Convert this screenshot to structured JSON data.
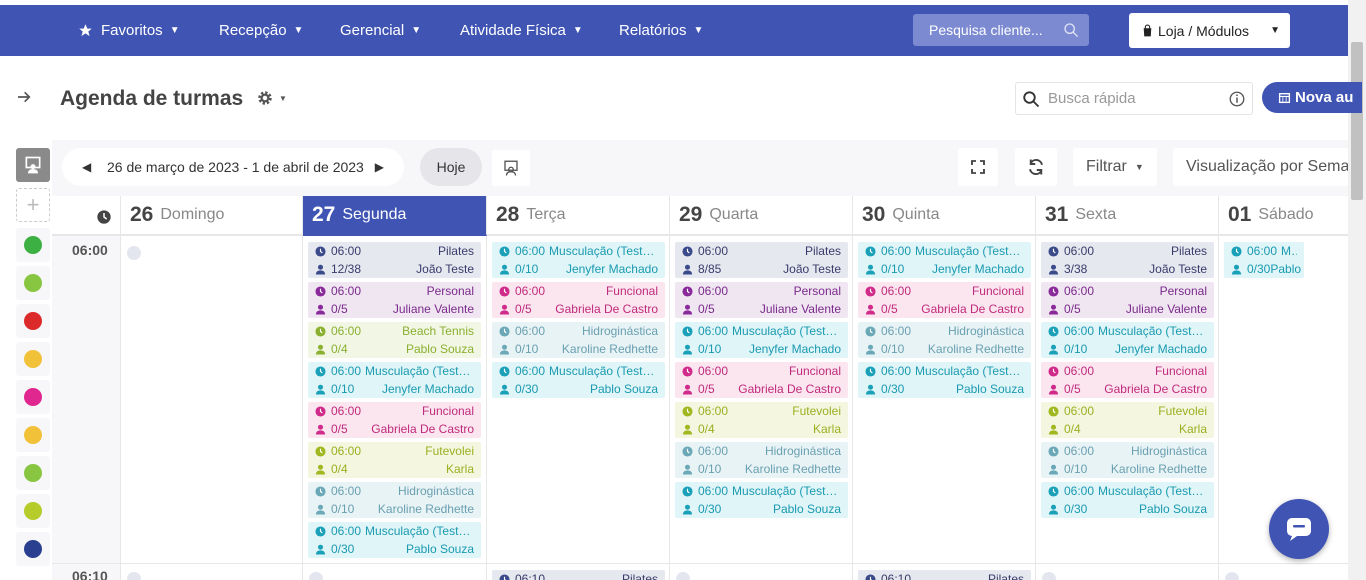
{
  "topnav": {
    "items": [
      {
        "label": "Favoritos"
      },
      {
        "label": "Recepção"
      },
      {
        "label": "Gerencial"
      },
      {
        "label": "Atividade Física"
      },
      {
        "label": "Relatórios"
      }
    ],
    "search_placeholder": "Pesquisa cliente...",
    "store_label": "Loja / Módulos"
  },
  "header": {
    "title": "Agenda de turmas",
    "quick_search_placeholder": "Busca rápida",
    "new_button": "Nova au"
  },
  "toolbar": {
    "date_range": "26 de março de 2023 - 1 de abril de 2023",
    "today": "Hoje",
    "filter": "Filtrar",
    "view": "Visualização por Seman"
  },
  "sidebar_colors": [
    "#3cb043",
    "#88c540",
    "#dc2a2a",
    "#f2c13a",
    "#e0278f",
    "#f2c13a",
    "#88c540",
    "#b5cc2a",
    "#2a3f8f"
  ],
  "days": [
    {
      "num": "26",
      "name": "Domingo",
      "active": false
    },
    {
      "num": "27",
      "name": "Segunda",
      "active": true
    },
    {
      "num": "28",
      "name": "Terça",
      "active": false
    },
    {
      "num": "29",
      "name": "Quarta",
      "active": false
    },
    {
      "num": "30",
      "name": "Quinta",
      "active": false
    },
    {
      "num": "31",
      "name": "Sexta",
      "active": false
    },
    {
      "num": "01",
      "name": "Sábado",
      "active": false
    }
  ],
  "slots": [
    "06:00",
    "06:10"
  ],
  "colors": {
    "Pilates": {
      "fg": "#3a3a6a",
      "bg": "#e6e8f0",
      "icon": "#3a4a8a"
    },
    "Personal": {
      "fg": "#7a2a8a",
      "bg": "#f0e6f2",
      "icon": "#8a2a9a"
    },
    "Beach Tennis": {
      "fg": "#8ab030",
      "bg": "#f2f6e4",
      "icon": "#8ab030"
    },
    "Musculacao": {
      "fg": "#1a9ab0",
      "bg": "#e0f5f8",
      "icon": "#1aa0b8"
    },
    "Funcional": {
      "fg": "#c02a7a",
      "bg": "#fbe6f0",
      "icon": "#d02a8a"
    },
    "Futevolei": {
      "fg": "#9ab020",
      "bg": "#f4f6e0",
      "icon": "#a0b820"
    },
    "Hidroginastica": {
      "fg": "#6aa0b0",
      "bg": "#e8f3f6",
      "icon": "#6aa8b8"
    }
  },
  "cards": {
    "d27": [
      {
        "time": "06:00",
        "title": "Pilates",
        "count": "12/38",
        "who": "João Teste",
        "style": "Pilates"
      },
      {
        "time": "06:00",
        "title": "Personal",
        "count": "0/5",
        "who": "Juliane Valente",
        "style": "Personal"
      },
      {
        "time": "06:00",
        "title": "Beach Tennis",
        "count": "0/4",
        "who": "Pablo Souza",
        "style": "Beach Tennis"
      },
      {
        "time": "06:00",
        "title": "Musculação (Teste ...",
        "count": "0/10",
        "who": "Jenyfer Machado",
        "style": "Musculacao"
      },
      {
        "time": "06:00",
        "title": "Funcional",
        "count": "0/5",
        "who": "Gabriela De Castro",
        "style": "Funcional"
      },
      {
        "time": "06:00",
        "title": "Futevolei",
        "count": "0/4",
        "who": "Karla",
        "style": "Futevolei"
      },
      {
        "time": "06:00",
        "title": "Hidroginástica",
        "count": "0/10",
        "who": "Karoline Redhette",
        "style": "Hidroginastica"
      },
      {
        "time": "06:00",
        "title": "Musculação (Teste ...",
        "count": "0/30",
        "who": "Pablo Souza",
        "style": "Musculacao"
      }
    ],
    "d28": [
      {
        "time": "06:00",
        "title": "Musculação (Teste ...",
        "count": "0/10",
        "who": "Jenyfer Machado",
        "style": "Musculacao"
      },
      {
        "time": "06:00",
        "title": "Funcional",
        "count": "0/5",
        "who": "Gabriela De Castro",
        "style": "Funcional"
      },
      {
        "time": "06:00",
        "title": "Hidroginástica",
        "count": "0/10",
        "who": "Karoline Redhette",
        "style": "Hidroginastica"
      },
      {
        "time": "06:00",
        "title": "Musculação (Teste ...",
        "count": "0/30",
        "who": "Pablo Souza",
        "style": "Musculacao"
      }
    ],
    "d29": [
      {
        "time": "06:00",
        "title": "Pilates",
        "count": "8/85",
        "who": "João Teste",
        "style": "Pilates"
      },
      {
        "time": "06:00",
        "title": "Personal",
        "count": "0/5",
        "who": "Juliane Valente",
        "style": "Personal"
      },
      {
        "time": "06:00",
        "title": "Musculação (Teste ...",
        "count": "0/10",
        "who": "Jenyfer Machado",
        "style": "Musculacao"
      },
      {
        "time": "06:00",
        "title": "Funcional",
        "count": "0/5",
        "who": "Gabriela De Castro",
        "style": "Funcional"
      },
      {
        "time": "06:00",
        "title": "Futevolei",
        "count": "0/4",
        "who": "Karla",
        "style": "Futevolei"
      },
      {
        "time": "06:00",
        "title": "Hidroginástica",
        "count": "0/10",
        "who": "Karoline Redhette",
        "style": "Hidroginastica"
      },
      {
        "time": "06:00",
        "title": "Musculação (Teste ...",
        "count": "0/30",
        "who": "Pablo Souza",
        "style": "Musculacao"
      }
    ],
    "d30": [
      {
        "time": "06:00",
        "title": "Musculação (Teste ...",
        "count": "0/10",
        "who": "Jenyfer Machado",
        "style": "Musculacao"
      },
      {
        "time": "06:00",
        "title": "Funcional",
        "count": "0/5",
        "who": "Gabriela De Castro",
        "style": "Funcional"
      },
      {
        "time": "06:00",
        "title": "Hidroginástica",
        "count": "0/10",
        "who": "Karoline Redhette",
        "style": "Hidroginastica"
      },
      {
        "time": "06:00",
        "title": "Musculação (Teste ...",
        "count": "0/30",
        "who": "Pablo Souza",
        "style": "Musculacao"
      }
    ],
    "d31": [
      {
        "time": "06:00",
        "title": "Pilates",
        "count": "3/38",
        "who": "João Teste",
        "style": "Pilates"
      },
      {
        "time": "06:00",
        "title": "Personal",
        "count": "0/5",
        "who": "Juliane Valente",
        "style": "Personal"
      },
      {
        "time": "06:00",
        "title": "Musculação (Teste ...",
        "count": "0/10",
        "who": "Jenyfer Machado",
        "style": "Musculacao"
      },
      {
        "time": "06:00",
        "title": "Funcional",
        "count": "0/5",
        "who": "Gabriela De Castro",
        "style": "Funcional"
      },
      {
        "time": "06:00",
        "title": "Futevolei",
        "count": "0/4",
        "who": "Karla",
        "style": "Futevolei"
      },
      {
        "time": "06:00",
        "title": "Hidroginástica",
        "count": "0/10",
        "who": "Karoline Redhette",
        "style": "Hidroginastica"
      },
      {
        "time": "06:00",
        "title": "Musculação (Teste ...",
        "count": "0/30",
        "who": "Pablo Souza",
        "style": "Musculacao"
      }
    ],
    "d01": [
      {
        "time": "06:00",
        "title": "Musculação (",
        "count": "0/30",
        "who": "Pablo",
        "style": "Musculacao"
      }
    ],
    "next28": {
      "time": "06:10",
      "title": "Pilates",
      "style": "Pilates"
    },
    "next30": {
      "time": "06:10",
      "title": "Pilates",
      "style": "Pilates"
    }
  }
}
